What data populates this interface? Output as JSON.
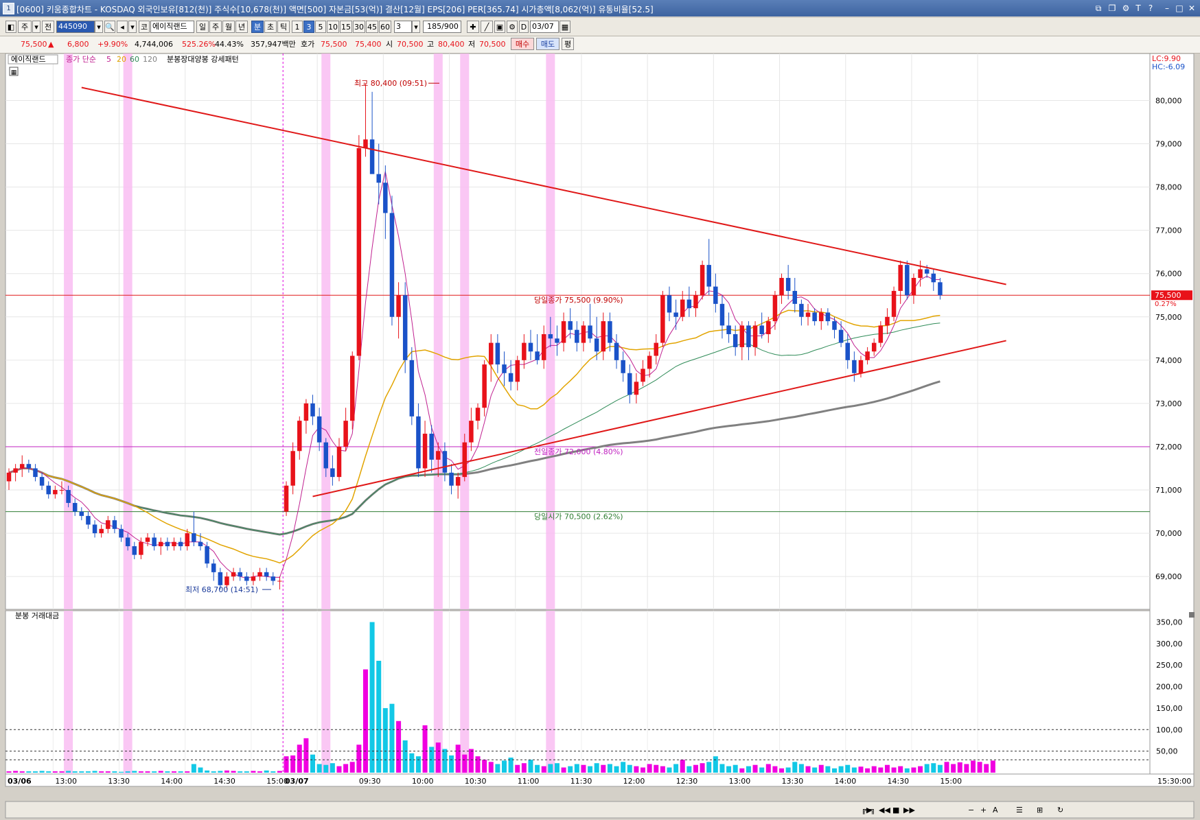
{
  "window": {
    "icon": "1",
    "title": "[0600] 키움종합차트 - KOSDAQ 외국인보유[812(천)] 주식수[10,678(천)] 액면[500] 자본금[53(억)] 결산[12월] EPS[206] PER[365.74] 시가총액[8,062(억)] 유통비율[52.5]"
  },
  "toolbar": {
    "mode": "주",
    "jeon": "전",
    "code": "445090",
    "ko": "코",
    "stock_name": "에이직랜드",
    "periods": [
      "일",
      "주",
      "월",
      "년",
      "분",
      "초",
      "틱"
    ],
    "selected_period": "분",
    "intervals": [
      "1",
      "3",
      "5",
      "10",
      "15",
      "30",
      "45",
      "60"
    ],
    "selected_interval": "3",
    "interval_input": "3",
    "count": "185/900",
    "d_label": "D",
    "date": "03/07"
  },
  "quote": {
    "price": "75,500",
    "arrow": "▲",
    "change": "6,800",
    "change_pct": "+9.90%",
    "volume": "4,744,006",
    "vol_ratio": "525.26%",
    "turnover": "44.43%",
    "amount": "357,947백만",
    "hoga_label": "호가",
    "ask": "75,500",
    "bid": "75,400",
    "open_label": "시",
    "open": "70,500",
    "high_label": "고",
    "high": "80,400",
    "low_label": "저",
    "low": "70,500",
    "buy": "매수",
    "sell": "매도",
    "pyeong": "평"
  },
  "legend": {
    "name": "에이직랜드",
    "ma_label": "종가 단순",
    "ma5": "5",
    "ma20": "20",
    "ma60": "60",
    "ma120": "120",
    "pattern": "분봉장대양봉 강세패턴",
    "volume_title": "분봉 거래대금"
  },
  "colors": {
    "up": "#e8121a",
    "down": "#1a52c8",
    "ma5": "#c02090",
    "ma20": "#e2a400",
    "ma60": "#2e8b57",
    "ma120": "#808080",
    "trend": "#e01818",
    "highlight": "#f9bdf2",
    "vol_up": "#f000e0",
    "vol_down": "#12c8e6"
  },
  "chart_data": [
    {
      "type": "candlestick",
      "title": "",
      "price_axis": {
        "min": 68400,
        "max": 80800,
        "ticks": [
          69000,
          70000,
          71000,
          72000,
          73000,
          74000,
          75000,
          76000,
          77000,
          78000,
          79000,
          80000
        ],
        "tick_labels": [
          "69,000",
          "70,000",
          "71,000",
          "72,000",
          "73,000",
          "74,000",
          "75,000",
          "76,000",
          "77,000",
          "78,000",
          "79,000",
          "80,000"
        ]
      },
      "time_labels": [
        "03/06",
        "13:00",
        "13:30",
        "14:00",
        "14:30",
        "15:00",
        "03/07",
        "09:30",
        "10:00",
        "10:30",
        "11:00",
        "11:30",
        "12:00",
        "12:30",
        "13:00",
        "13:30",
        "14:00",
        "14:30",
        "15:00",
        "15:30:00"
      ],
      "axis_badges": {
        "lc": "LC:9.90",
        "hc": "HC:-6.09",
        "price": "75,500",
        "pct": "0.27%"
      },
      "annotations": {
        "high": "최고 80,400 (09:51)",
        "low": "최저 68,700 (14:51)",
        "close_line": "당일종가 75,500 (9.90%)",
        "prev_close": "전일종가 72,000 (4.80%)",
        "open_line": "당일시가 70,500 (2.62%)"
      },
      "levels": {
        "close": 75500,
        "prev_close": 72000,
        "open": 70500
      },
      "trendlines": [
        {
          "from": [
            80300,
            11
          ],
          "to": [
            75750,
            151
          ]
        },
        {
          "from": [
            70850,
            46
          ],
          "to": [
            74450,
            151
          ]
        }
      ],
      "highlight_bars": [
        9,
        18,
        48,
        65,
        69,
        82
      ],
      "ohlc": [
        [
          71200,
          71500,
          71000,
          71400
        ],
        [
          71400,
          71600,
          71200,
          71500
        ],
        [
          71500,
          71800,
          71300,
          71600
        ],
        [
          71600,
          71700,
          71400,
          71500
        ],
        [
          71500,
          71600,
          71200,
          71300
        ],
        [
          71300,
          71400,
          71000,
          71100
        ],
        [
          71100,
          71200,
          70800,
          70900
        ],
        [
          70900,
          71100,
          70800,
          71000
        ],
        [
          71000,
          71200,
          70900,
          71000
        ],
        [
          71000,
          71100,
          70600,
          70700
        ],
        [
          70700,
          70800,
          70400,
          70500
        ],
        [
          70500,
          70600,
          70300,
          70400
        ],
        [
          70400,
          70500,
          70100,
          70200
        ],
        [
          70200,
          70300,
          69900,
          70000
        ],
        [
          70000,
          70200,
          69900,
          70100
        ],
        [
          70100,
          70400,
          70000,
          70300
        ],
        [
          70300,
          70400,
          70000,
          70100
        ],
        [
          70100,
          70200,
          69800,
          69900
        ],
        [
          69900,
          70000,
          69600,
          69700
        ],
        [
          69700,
          69800,
          69400,
          69500
        ],
        [
          69500,
          69900,
          69400,
          69800
        ],
        [
          69800,
          70000,
          69700,
          69900
        ],
        [
          69900,
          70000,
          69600,
          69700
        ],
        [
          69700,
          69900,
          69500,
          69800
        ],
        [
          69800,
          69900,
          69600,
          69700
        ],
        [
          69700,
          69900,
          69600,
          69800
        ],
        [
          69800,
          69900,
          69600,
          69700
        ],
        [
          69700,
          70100,
          69600,
          70000
        ],
        [
          70000,
          70500,
          69700,
          69800
        ],
        [
          69800,
          70000,
          69600,
          69700
        ],
        [
          69700,
          69800,
          69200,
          69300
        ],
        [
          69300,
          69400,
          68900,
          69100
        ],
        [
          69100,
          69200,
          68700,
          68800
        ],
        [
          68800,
          69100,
          68700,
          69000
        ],
        [
          69000,
          69200,
          68900,
          69100
        ],
        [
          69100,
          69200,
          68900,
          69000
        ],
        [
          69000,
          69100,
          68800,
          68900
        ],
        [
          68900,
          69100,
          68800,
          69000
        ],
        [
          69000,
          69200,
          68900,
          69100
        ],
        [
          69100,
          69200,
          68900,
          69000
        ],
        [
          69000,
          69100,
          68800,
          68900
        ],
        [
          68900,
          69000,
          68700,
          68900
        ],
        [
          70500,
          71200,
          70400,
          71100
        ],
        [
          71100,
          72100,
          70900,
          71900
        ],
        [
          71900,
          72700,
          71700,
          72600
        ],
        [
          72600,
          73100,
          72300,
          73000
        ],
        [
          73000,
          73200,
          72500,
          72700
        ],
        [
          72700,
          72900,
          71900,
          72100
        ],
        [
          72100,
          72200,
          71300,
          71500
        ],
        [
          71500,
          71800,
          71100,
          71300
        ],
        [
          71300,
          72200,
          71200,
          72000
        ],
        [
          72000,
          72900,
          71900,
          72600
        ],
        [
          72600,
          74200,
          72400,
          74100
        ],
        [
          74100,
          79200,
          74000,
          78900
        ],
        [
          78900,
          80400,
          78700,
          79100
        ],
        [
          79100,
          80200,
          78500,
          78300
        ],
        [
          78300,
          79000,
          77600,
          78100
        ],
        [
          78100,
          78500,
          76800,
          77400
        ],
        [
          77400,
          77800,
          74800,
          75000
        ],
        [
          75000,
          75800,
          74500,
          75500
        ],
        [
          75500,
          75800,
          73700,
          74000
        ],
        [
          74000,
          74300,
          72500,
          72700
        ],
        [
          72700,
          73000,
          71300,
          71500
        ],
        [
          71500,
          72600,
          71300,
          72300
        ],
        [
          72300,
          72500,
          71400,
          71700
        ],
        [
          71700,
          72100,
          71300,
          71900
        ],
        [
          71900,
          72100,
          71200,
          71400
        ],
        [
          71400,
          71600,
          70900,
          71100
        ],
        [
          71100,
          71400,
          70800,
          71300
        ],
        [
          71300,
          72300,
          71200,
          72100
        ],
        [
          72100,
          72900,
          71900,
          72600
        ],
        [
          72600,
          73000,
          72400,
          72900
        ],
        [
          72900,
          74000,
          72700,
          73900
        ],
        [
          73900,
          74600,
          73500,
          74400
        ],
        [
          74400,
          74600,
          73700,
          73900
        ],
        [
          73900,
          74200,
          73400,
          73700
        ],
        [
          73700,
          74000,
          73300,
          73500
        ],
        [
          73500,
          74100,
          73300,
          74000
        ],
        [
          74000,
          74600,
          73800,
          74400
        ],
        [
          74400,
          74700,
          74000,
          74200
        ],
        [
          74200,
          74600,
          73900,
          74000
        ],
        [
          74000,
          74800,
          73800,
          74600
        ],
        [
          74600,
          75000,
          74300,
          74500
        ],
        [
          74500,
          74800,
          74100,
          74400
        ],
        [
          74400,
          75100,
          74200,
          74900
        ],
        [
          74900,
          75200,
          74500,
          74700
        ],
        [
          74700,
          74900,
          74200,
          74400
        ],
        [
          74400,
          74900,
          74200,
          74800
        ],
        [
          74800,
          75300,
          74400,
          74500
        ],
        [
          74500,
          75000,
          74000,
          74200
        ],
        [
          74200,
          75100,
          74000,
          74900
        ],
        [
          74900,
          75100,
          74200,
          74400
        ],
        [
          74400,
          74600,
          73800,
          74000
        ],
        [
          74000,
          74200,
          73500,
          73700
        ],
        [
          73700,
          73900,
          73000,
          73200
        ],
        [
          73200,
          73700,
          73000,
          73500
        ],
        [
          73500,
          74000,
          73400,
          73800
        ],
        [
          73800,
          74200,
          73600,
          74100
        ],
        [
          74100,
          74600,
          73900,
          74400
        ],
        [
          74400,
          75600,
          74300,
          75500
        ],
        [
          75500,
          75700,
          74900,
          75100
        ],
        [
          75100,
          75400,
          74700,
          75000
        ],
        [
          75000,
          75600,
          74900,
          75400
        ],
        [
          75400,
          75700,
          75000,
          75200
        ],
        [
          75200,
          75600,
          75000,
          75500
        ],
        [
          75500,
          76300,
          75400,
          76200
        ],
        [
          76200,
          76800,
          75500,
          75700
        ],
        [
          75700,
          76000,
          75100,
          75300
        ],
        [
          75300,
          75500,
          74500,
          74800
        ],
        [
          74800,
          75100,
          74400,
          74600
        ],
        [
          74600,
          74800,
          74100,
          74300
        ],
        [
          74300,
          74900,
          74000,
          74800
        ],
        [
          74800,
          74900,
          74000,
          74300
        ],
        [
          74300,
          74900,
          74100,
          74800
        ],
        [
          74800,
          75100,
          74500,
          74600
        ],
        [
          74600,
          75000,
          74400,
          74900
        ],
        [
          74900,
          75600,
          74700,
          75500
        ],
        [
          75500,
          76000,
          75300,
          75900
        ],
        [
          75900,
          76200,
          75400,
          75600
        ],
        [
          75600,
          75900,
          75100,
          75300
        ],
        [
          75300,
          75400,
          74800,
          75000
        ],
        [
          75000,
          75300,
          74800,
          75100
        ],
        [
          75100,
          75200,
          74800,
          74900
        ],
        [
          74900,
          75200,
          74700,
          75100
        ],
        [
          75100,
          75200,
          74800,
          74900
        ],
        [
          74900,
          75000,
          74500,
          74700
        ],
        [
          74700,
          74900,
          74300,
          74400
        ],
        [
          74400,
          74600,
          73800,
          74000
        ],
        [
          74000,
          74200,
          73500,
          73700
        ],
        [
          73700,
          74100,
          73600,
          74000
        ],
        [
          74000,
          74300,
          73900,
          74200
        ],
        [
          74200,
          74500,
          74100,
          74400
        ],
        [
          74400,
          74900,
          74300,
          74800
        ],
        [
          74800,
          75200,
          74600,
          75000
        ],
        [
          75000,
          75700,
          74900,
          75600
        ],
        [
          75600,
          76300,
          75300,
          76200
        ],
        [
          76200,
          76300,
          75400,
          75500
        ],
        [
          75500,
          76000,
          75300,
          75900
        ],
        [
          75900,
          76300,
          75700,
          76100
        ],
        [
          76100,
          76200,
          75900,
          76000
        ],
        [
          76000,
          76100,
          75600,
          75800
        ],
        [
          75800,
          75900,
          75400,
          75500
        ]
      ]
    },
    {
      "type": "bar",
      "title": "분봉 거래대금",
      "y_axis": {
        "max": 370,
        "ticks": [
          50,
          100,
          150,
          200,
          250,
          300,
          350
        ],
        "tick_labels": [
          "50,00",
          "100,00",
          "150,00",
          "200,00",
          "250,00",
          "300,00",
          "350,00"
        ],
        "dashed": [
          100,
          50,
          30
        ]
      },
      "values": [
        3,
        4,
        3,
        3,
        3,
        4,
        3,
        3,
        3,
        4,
        3,
        3,
        3,
        4,
        3,
        3,
        3,
        2,
        3,
        4,
        3,
        3,
        3,
        4,
        3,
        3,
        3,
        3,
        20,
        12,
        5,
        3,
        4,
        5,
        4,
        3,
        3,
        4,
        3,
        5,
        3,
        4,
        38,
        40,
        65,
        80,
        42,
        20,
        18,
        22,
        15,
        20,
        25,
        65,
        240,
        350,
        260,
        150,
        160,
        120,
        75,
        45,
        38,
        110,
        60,
        70,
        55,
        40,
        65,
        42,
        55,
        38,
        30,
        25,
        20,
        28,
        35,
        18,
        22,
        30,
        18,
        15,
        20,
        22,
        12,
        15,
        20,
        18,
        15,
        22,
        18,
        20,
        15,
        25,
        18,
        15,
        12,
        20,
        18,
        15,
        12,
        20,
        30,
        15,
        18,
        22,
        25,
        38,
        20,
        15,
        18,
        10,
        15,
        18,
        12,
        20,
        15,
        10,
        12,
        25,
        20,
        15,
        12,
        18,
        15,
        10,
        15,
        18,
        12,
        14,
        10,
        15,
        12,
        18,
        12,
        15,
        10,
        12,
        15,
        20,
        22,
        18,
        25,
        20,
        24,
        20,
        28,
        25,
        20,
        28
      ]
    }
  ]
}
